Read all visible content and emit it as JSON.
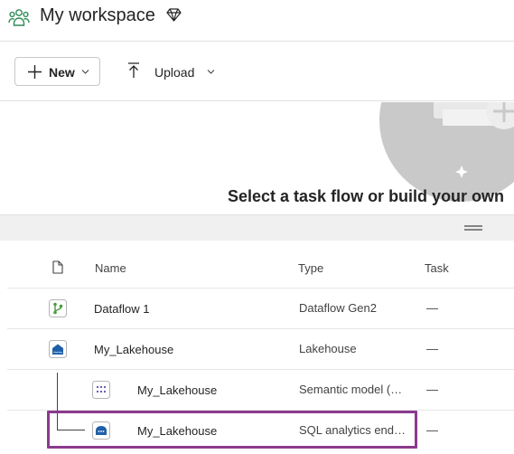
{
  "header": {
    "workspace_title": "My workspace",
    "workspace_icon": "people-group-icon",
    "premium_icon": "diamond-icon"
  },
  "toolbar": {
    "new_label": "New",
    "upload_label": "Upload"
  },
  "banner": {
    "title": "Select a task flow or build your own"
  },
  "table": {
    "columns": {
      "name": "Name",
      "type": "Type",
      "task": "Task"
    },
    "rows": [
      {
        "name": "Dataflow 1",
        "type": "Dataflow Gen2",
        "task": "—",
        "icon": "dataflow-icon"
      },
      {
        "name": "My_Lakehouse",
        "type": "Lakehouse",
        "task": "—",
        "icon": "lakehouse-icon"
      },
      {
        "name": "My_Lakehouse",
        "type": "Semantic model (…",
        "task": "—",
        "icon": "semantic-model-icon"
      },
      {
        "name": "My_Lakehouse",
        "type": "SQL analytics end…",
        "task": "—",
        "icon": "sql-endpoint-icon"
      }
    ]
  },
  "colors": {
    "highlight": "#8b3a8f",
    "dataflow_green": "#4a9b3f",
    "lakehouse_blue": "#1f5fa8"
  }
}
